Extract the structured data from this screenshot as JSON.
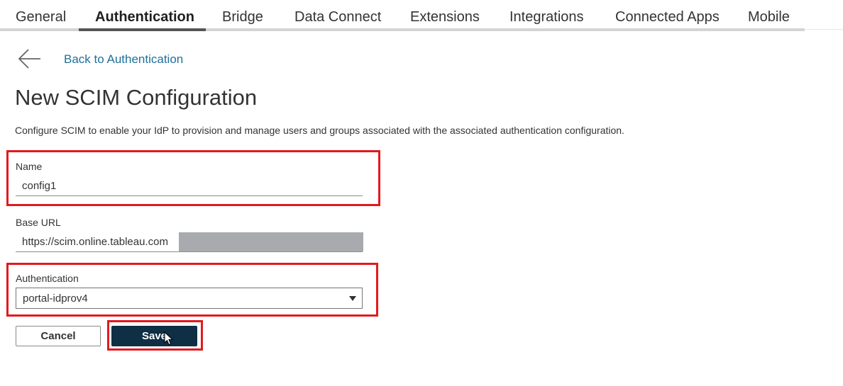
{
  "tabs": [
    {
      "label": "General"
    },
    {
      "label": "Authentication",
      "active": true
    },
    {
      "label": "Bridge"
    },
    {
      "label": "Data Connect"
    },
    {
      "label": "Extensions"
    },
    {
      "label": "Integrations"
    },
    {
      "label": "Connected Apps"
    },
    {
      "label": "Mobile"
    }
  ],
  "back": {
    "icon": "arrow-left-icon",
    "label": "Back to Authentication"
  },
  "page": {
    "title": "New SCIM Configuration",
    "description": "Configure SCIM to enable your IdP to provision and manage users and groups associated with the associated authentication configuration."
  },
  "form": {
    "name": {
      "label": "Name",
      "value": "config1"
    },
    "base_url": {
      "label": "Base URL",
      "value": "https://scim.online.tableau.com"
    },
    "authentication": {
      "label": "Authentication",
      "selected": "portal-idprov4"
    }
  },
  "buttons": {
    "cancel": "Cancel",
    "save": "Save"
  },
  "colors": {
    "highlight": "#e3191d",
    "save_button": "#0f2f45",
    "link": "#1f6f9a",
    "redaction": "#a9aaad"
  }
}
